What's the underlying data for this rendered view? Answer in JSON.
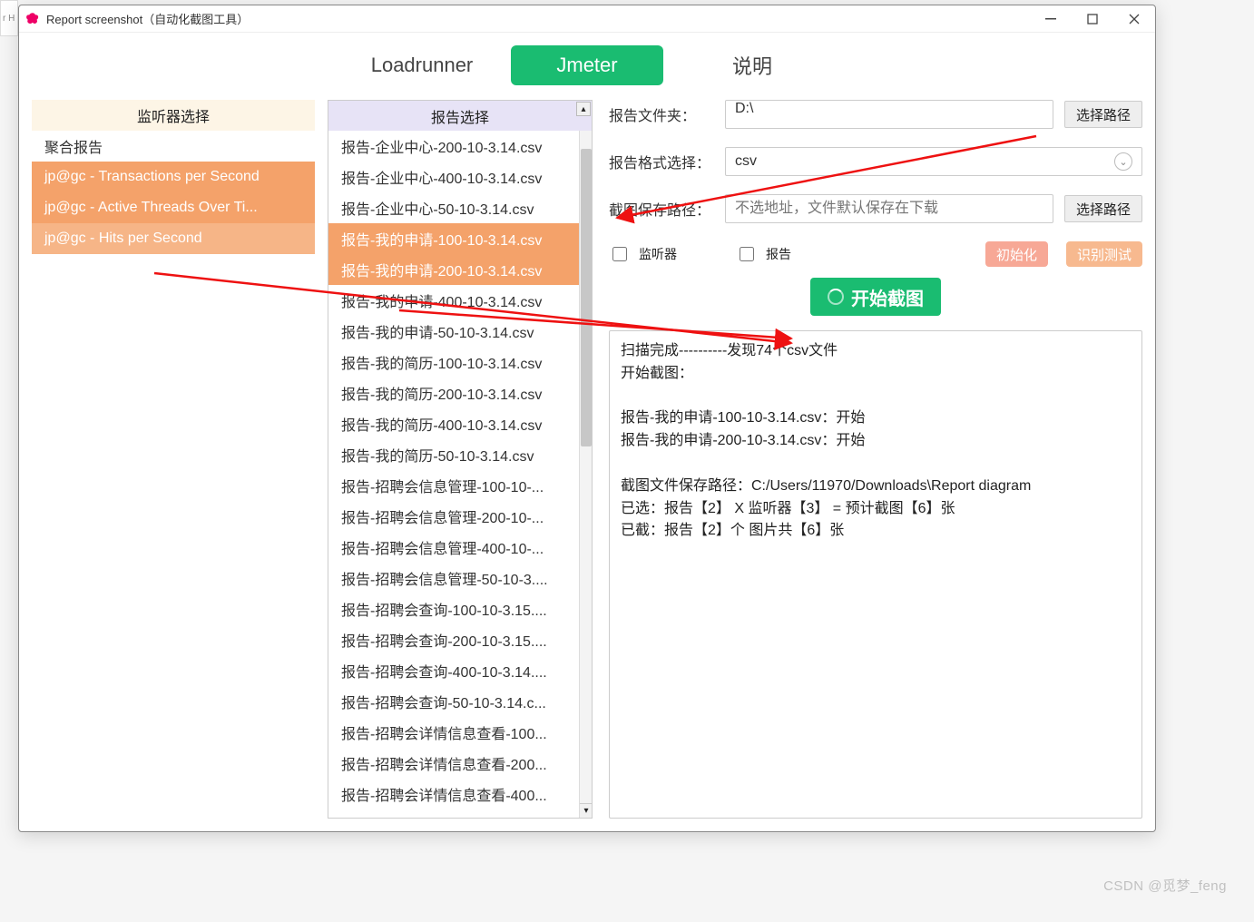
{
  "window": {
    "title": "Report screenshot（自动化截图工具）",
    "side_tab_hint": "r H"
  },
  "tabs": {
    "loadrunner": "Loadrunner",
    "jmeter": "Jmeter",
    "help": "说明",
    "active": "jmeter"
  },
  "left_panel": {
    "header": "监听器选择",
    "items": [
      {
        "label": "聚合报告",
        "selected": false
      },
      {
        "label": "jp@gc - Transactions per Second",
        "selected": true
      },
      {
        "label": "jp@gc - Active Threads Over Ti...",
        "selected": true
      },
      {
        "label": "jp@gc - Hits per Second",
        "selected": true
      }
    ]
  },
  "mid_panel": {
    "header": "报告选择",
    "items": [
      {
        "label": "报告-企业中心-200-10-3.14.csv",
        "selected": false
      },
      {
        "label": "报告-企业中心-400-10-3.14.csv",
        "selected": false
      },
      {
        "label": "报告-企业中心-50-10-3.14.csv",
        "selected": false
      },
      {
        "label": "报告-我的申请-100-10-3.14.csv",
        "selected": true
      },
      {
        "label": "报告-我的申请-200-10-3.14.csv",
        "selected": true
      },
      {
        "label": "报告-我的申请-400-10-3.14.csv",
        "selected": false
      },
      {
        "label": "报告-我的申请-50-10-3.14.csv",
        "selected": false
      },
      {
        "label": "报告-我的简历-100-10-3.14.csv",
        "selected": false
      },
      {
        "label": "报告-我的简历-200-10-3.14.csv",
        "selected": false
      },
      {
        "label": "报告-我的简历-400-10-3.14.csv",
        "selected": false
      },
      {
        "label": "报告-我的简历-50-10-3.14.csv",
        "selected": false
      },
      {
        "label": "报告-招聘会信息管理-100-10-...",
        "selected": false
      },
      {
        "label": "报告-招聘会信息管理-200-10-...",
        "selected": false
      },
      {
        "label": "报告-招聘会信息管理-400-10-...",
        "selected": false
      },
      {
        "label": "报告-招聘会信息管理-50-10-3....",
        "selected": false
      },
      {
        "label": "报告-招聘会查询-100-10-3.15....",
        "selected": false
      },
      {
        "label": "报告-招聘会查询-200-10-3.15....",
        "selected": false
      },
      {
        "label": "报告-招聘会查询-400-10-3.14....",
        "selected": false
      },
      {
        "label": "报告-招聘会查询-50-10-3.14.c...",
        "selected": false
      },
      {
        "label": "报告-招聘会详情信息查看-100...",
        "selected": false
      },
      {
        "label": "报告-招聘会详情信息查看-200...",
        "selected": false
      },
      {
        "label": "报告-招聘会详情信息查看-400...",
        "selected": false
      }
    ]
  },
  "form": {
    "folder_label": "报告文件夹：",
    "folder_value": "D:\\",
    "choose_path_btn": "选择路径",
    "format_label": "报告格式选择：",
    "format_value": "csv",
    "save_label": "截图保存路径：",
    "save_placeholder": "不选地址，文件默认保存在下载",
    "listener_checkbox": "监听器",
    "report_checkbox": "报告",
    "init_btn": "初始化",
    "test_btn": "识别测试",
    "start_btn": "开始截图"
  },
  "log": {
    "text": "扫描完成----------发现74个csv文件\n开始截图：\n\n报告-我的申请-100-10-3.14.csv：开始\n报告-我的申请-200-10-3.14.csv：开始\n\n截图文件保存路径：C:/Users/11970/Downloads\\Report diagram\n已选：报告【2】 X 监听器【3】 = 预计截图【6】张\n已截：报告【2】个            图片共【6】张"
  },
  "watermark": "CSDN @觅梦_feng"
}
